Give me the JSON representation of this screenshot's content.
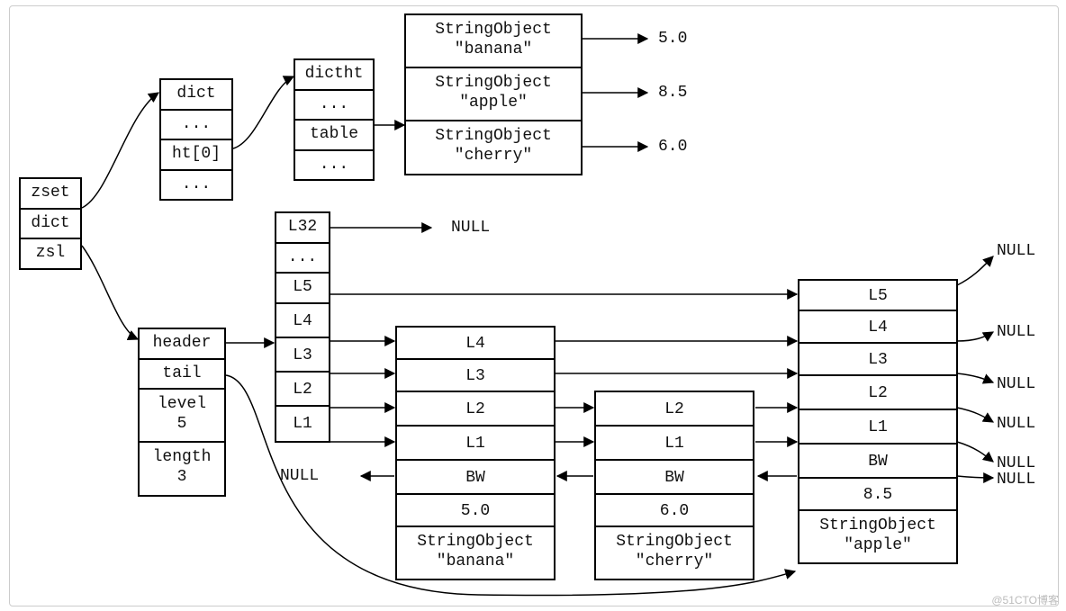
{
  "zset": {
    "title": "zset",
    "dict": "dict",
    "zsl": "zsl"
  },
  "dict": {
    "title": "dict",
    "dots": "...",
    "ht0": "ht[0]",
    "dots2": "..."
  },
  "dictht": {
    "title": "dictht",
    "dots": "...",
    "table": "table",
    "dots2": "..."
  },
  "string_objects": {
    "type": "StringObject",
    "banana": "\"banana\"",
    "apple": "\"apple\"",
    "cherry": "\"cherry\"",
    "score_banana": "5.0",
    "score_apple": "8.5",
    "score_cherry": "6.0"
  },
  "zsl_meta": {
    "header": "header",
    "tail": "tail",
    "level_label": "level",
    "level_value": "5",
    "length_label": "length",
    "length_value": "3"
  },
  "header_col": {
    "L32": "L32",
    "dots": "...",
    "L5": "L5",
    "L4": "L4",
    "L3": "L3",
    "L2": "L2",
    "L1": "L1"
  },
  "node": {
    "L5": "L5",
    "L4": "L4",
    "L3": "L3",
    "L2": "L2",
    "L1": "L1",
    "BW": "BW",
    "score_banana": "5.0",
    "score_cherry": "6.0",
    "score_apple": "8.5"
  },
  "null": "NULL",
  "watermark": "@51CTO博客"
}
